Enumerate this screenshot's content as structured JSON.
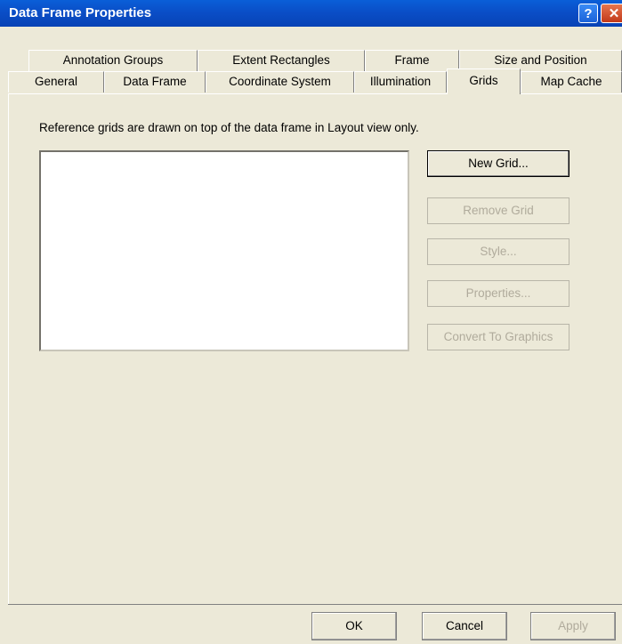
{
  "window": {
    "title": "Data Frame Properties",
    "help_glyph": "?",
    "close_glyph": "✕"
  },
  "tabs_top": [
    "Annotation Groups",
    "Extent Rectangles",
    "Frame",
    "Size and Position"
  ],
  "tabs_bottom": [
    "General",
    "Data Frame",
    "Coordinate System",
    "Illumination",
    "Grids",
    "Map Cache"
  ],
  "active_tab": "Grids",
  "grids": {
    "description": "Reference grids are drawn on top of the data frame in Layout view only.",
    "new_grid": "New Grid...",
    "remove_grid": "Remove Grid",
    "style": "Style...",
    "properties": "Properties...",
    "convert": "Convert To Graphics"
  },
  "footer": {
    "ok": "OK",
    "cancel": "Cancel",
    "apply": "Apply"
  }
}
